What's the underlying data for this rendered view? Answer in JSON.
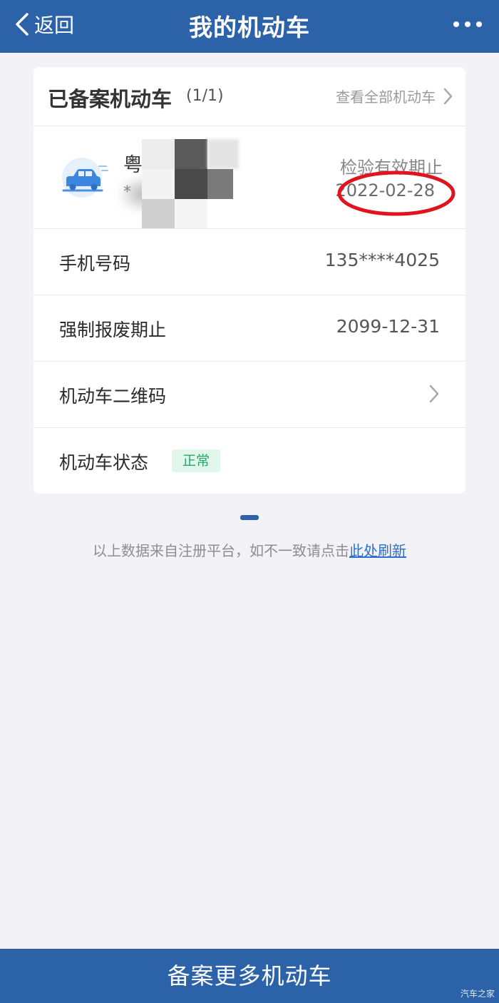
{
  "topbar": {
    "back_label": "返回",
    "title": "我的机动车",
    "more_icon": "more-dots-icon"
  },
  "card": {
    "title": "已备案机动车",
    "count": "(1/1)",
    "view_all": "查看全部机动车",
    "vehicle": {
      "plate_prefix": "粤",
      "plate_sub": "*",
      "expiry_label": "检验有效期止",
      "expiry_date": "2022-02-28",
      "icon": "car-icon"
    },
    "rows": [
      {
        "label": "手机号码",
        "value": "135****4025"
      },
      {
        "label": "强制报废期止",
        "value": "2099-12-31"
      },
      {
        "label": "机动车二维码",
        "value": ""
      },
      {
        "label": "机动车状态",
        "badge": "正常"
      }
    ]
  },
  "footnote": {
    "text": "以上数据来自注册平台，如不一致请点击",
    "link": "此处刷新"
  },
  "bottom_button": "备案更多机动车",
  "watermark": "汽车之家",
  "colors": {
    "primary": "#2c62a8",
    "annotation_red": "#e0141e",
    "status_green": "#22a86b"
  }
}
